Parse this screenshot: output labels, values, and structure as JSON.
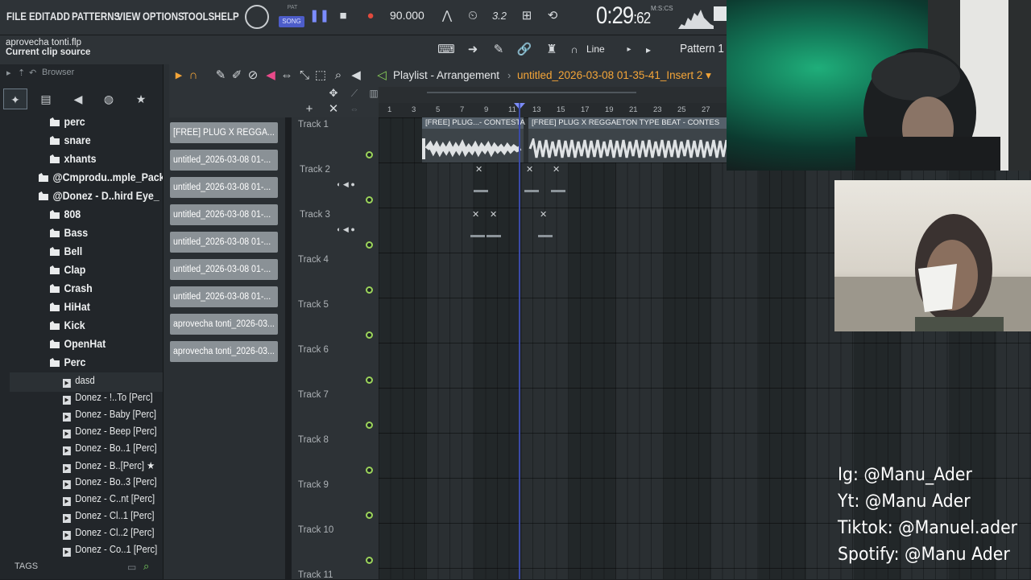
{
  "menu": [
    "FILE",
    "EDIT",
    "ADD",
    "PATTERNS",
    "VIEW",
    "OPTIONS",
    "TOOLS",
    "HELP"
  ],
  "transport": {
    "pat_label": "PAT",
    "song_label": "SONG",
    "tempo": "90.000",
    "time_main": "0:29",
    "time_frac": ":62",
    "time_format": "M:S:CS"
  },
  "hint": {
    "line1": "aprovecha tonti.flp",
    "line2": "Current clip source"
  },
  "toolbar2": {
    "snap": "Line",
    "pattern": "Pattern 1"
  },
  "browser": {
    "title": "Browser",
    "folders": [
      {
        "label": "perc",
        "indent": 60
      },
      {
        "label": "snare",
        "indent": 60
      },
      {
        "label": "xhants",
        "indent": 60
      },
      {
        "label": "@Cmprodu..mple_Pack",
        "indent": 46
      },
      {
        "label": "@Donez - D..hird Eye_",
        "indent": 46
      },
      {
        "label": "808",
        "indent": 60
      },
      {
        "label": "Bass",
        "indent": 60
      },
      {
        "label": "Bell",
        "indent": 60
      },
      {
        "label": "Clap",
        "indent": 60
      },
      {
        "label": "Crash",
        "indent": 60
      },
      {
        "label": "HiHat",
        "indent": 60
      },
      {
        "label": "Kick",
        "indent": 60
      },
      {
        "label": "OpenHat",
        "indent": 60
      },
      {
        "label": "Perc",
        "indent": 60
      }
    ],
    "files": [
      "dasd",
      "Donez - !..To [Perc]",
      "Donez - Baby [Perc]",
      "Donez - Beep [Perc]",
      "Donez - Bo..1 [Perc]",
      "Donez - B..[Perc] ★",
      "Donez - Bo..3 [Perc]",
      "Donez - C..nt [Perc]",
      "Donez - Cl..1 [Perc]",
      "Donez - Cl..2 [Perc]",
      "Donez - Co..1 [Perc]"
    ],
    "tags": "TAGS"
  },
  "clips": [
    "[FREE] PLUG X REGGA...",
    "untitled_2026-03-08 01-...",
    "untitled_2026-03-08 01-...",
    "untitled_2026-03-08 01-...",
    "untitled_2026-03-08 01-...",
    "untitled_2026-03-08 01-...",
    "untitled_2026-03-08 01-...",
    "aprovecha tonti_2026-03...",
    "aprovecha tonti_2026-03..."
  ],
  "playlist": {
    "title": "Playlist - Arrangement",
    "arrow": "›",
    "subtitle": "untitled_2026-03-08 01-35-41_Insert 2 ▾",
    "ruler": [
      "1",
      "3",
      "5",
      "7",
      "9",
      "11",
      "13",
      "15",
      "17",
      "19",
      "21",
      "23",
      "25",
      "27"
    ],
    "tracks": [
      "Track 1",
      "Track 2",
      "Track 3",
      "Track 4",
      "Track 5",
      "Track 6",
      "Track 7",
      "Track 8",
      "Track 9",
      "Track 10",
      "Track 11"
    ],
    "audio_clip1": "[FREE] PLUG...- CONTESTA",
    "audio_clip2": "[FREE] PLUG X REGGAETON TYPE BEAT - CONTES"
  },
  "social": [
    "Ig: @Manu_Ader",
    "Yt: @Manu Ader",
    "Tiktok: @Manuel.ader",
    "Spotify: @Manu Ader"
  ],
  "colors": {
    "accent_orange": "#f4a538",
    "track_dot": "#9bd45a",
    "playhead": "#3a4aa8"
  }
}
